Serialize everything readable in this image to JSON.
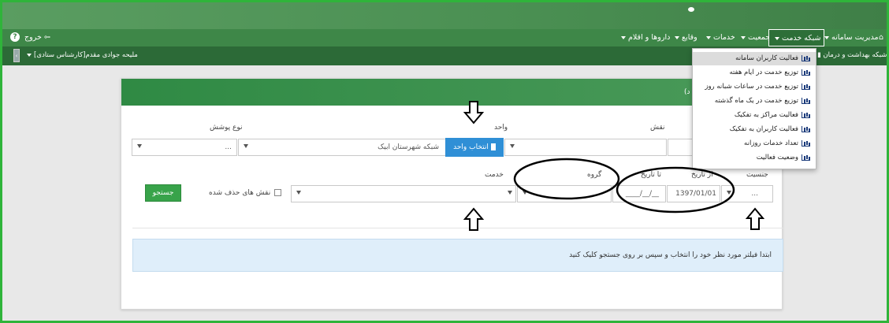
{
  "topbar": {
    "home_label": "مدیریت سامانه",
    "menu": [
      {
        "label": "شبکه خدمت"
      },
      {
        "label": "جمعیت"
      },
      {
        "label": "خدمات"
      },
      {
        "label": "وقایع"
      },
      {
        "label": "داروها و اقلام"
      }
    ],
    "exit_label": "خروج"
  },
  "subbar": {
    "user_label": "ملیحه جوادی مقدم[کارشناس ستادی]",
    "network_label": "شبکه بهداشت و درمان"
  },
  "dropdown": {
    "items": [
      {
        "label": "فعالیت کاربران سامانه"
      },
      {
        "label": "توزیع خدمت در ایام هفته"
      },
      {
        "label": "توزیع خدمت در ساعات شبانه روز"
      },
      {
        "label": "توزیع خدمت در یک ماه گذشته"
      },
      {
        "label": "فعالیت مراکز به تفکیک"
      },
      {
        "label": "فعالیت کاربران به تفکیک"
      },
      {
        "label": "تعداد خدمات روزانه"
      },
      {
        "label": "وضعیت فعالیت"
      }
    ]
  },
  "card": {
    "header_text": "د)",
    "labels": {
      "coverage": "نوع پوشش",
      "unit": "واحد",
      "role": "نقش",
      "gender": "جنسیت",
      "from_date": "از تاریخ",
      "to_date": "تا تاریخ",
      "group": "گروه",
      "service": "خدمت",
      "deleted_roles": "نقش های حذف شده"
    },
    "unit_value": "شبکه شهرستان ابیک",
    "unit_button": "انتخاب واحد",
    "coverage_value": "...",
    "gender_value": "...",
    "from_date_value": "1397/01/01",
    "to_date_value": "__/__/____",
    "search_button": "جستجو",
    "info_text": "ابتدا فیلتر مورد نظر خود را انتخاب و سپس بر روی جستجو کلیک کنید"
  },
  "colors": {
    "accent": "#3e8748",
    "button": "#38a34a",
    "unit_button": "#2f8fd6",
    "info_bg": "#dfeefa"
  }
}
